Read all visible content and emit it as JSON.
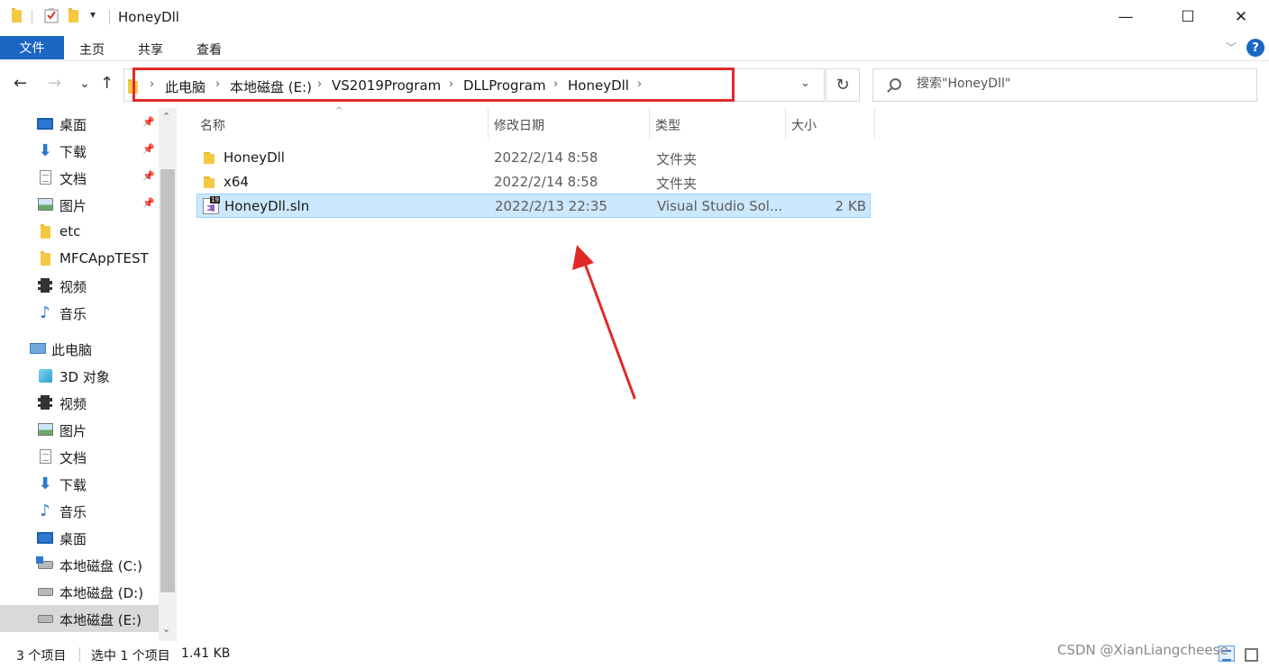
{
  "window": {
    "title": "HoneyDll",
    "minimize_glyph": "—",
    "maximize_glyph": "☐",
    "close_glyph": "✕",
    "qa_dropdown_glyph": "▾"
  },
  "ribbon": {
    "file_tab": "文件",
    "tabs": [
      "主页",
      "共享",
      "查看"
    ],
    "expand_glyph": "﹀",
    "help_glyph": "?"
  },
  "nav": {
    "back_glyph": "←",
    "forward_glyph": "→",
    "recent_glyph": "⌄",
    "up_glyph": "↑",
    "refresh_glyph": "↻",
    "dropdown_glyph": "⌄"
  },
  "address": {
    "breadcrumbs": [
      "此电脑",
      "本地磁盘 (E:)",
      "VS2019Program",
      "DLLProgram",
      "HoneyDll"
    ],
    "separator": "›"
  },
  "search": {
    "placeholder": "搜索\"HoneyDll\""
  },
  "navpane": {
    "quick_access": [
      {
        "label": "桌面",
        "icon": "desktop-icon",
        "pinned": true
      },
      {
        "label": "下载",
        "icon": "download-icon",
        "pinned": true
      },
      {
        "label": "文档",
        "icon": "document-icon",
        "pinned": true
      },
      {
        "label": "图片",
        "icon": "picture-icon",
        "pinned": true
      },
      {
        "label": "etc",
        "icon": "folder-icon",
        "pinned": false
      },
      {
        "label": "MFCAppTEST",
        "icon": "folder-icon",
        "pinned": false
      },
      {
        "label": "视频",
        "icon": "video-icon",
        "pinned": false
      },
      {
        "label": "音乐",
        "icon": "music-icon",
        "pinned": false
      }
    ],
    "this_pc": "此电脑",
    "this_pc_items": [
      {
        "label": "3D 对象",
        "icon": "3d-objects-icon"
      },
      {
        "label": "视频",
        "icon": "video-icon"
      },
      {
        "label": "图片",
        "icon": "picture-icon"
      },
      {
        "label": "文档",
        "icon": "document-icon"
      },
      {
        "label": "下载",
        "icon": "download-icon"
      },
      {
        "label": "音乐",
        "icon": "music-icon"
      },
      {
        "label": "桌面",
        "icon": "desktop-icon"
      },
      {
        "label": "本地磁盘 (C:)",
        "icon": "system-drive-icon"
      },
      {
        "label": "本地磁盘 (D:)",
        "icon": "drive-icon"
      },
      {
        "label": "本地磁盘 (E:)",
        "icon": "drive-icon",
        "selected": true
      }
    ],
    "pin_glyph": "📌",
    "scroll_up_glyph": "⌃",
    "scroll_down_glyph": "⌄"
  },
  "filelist": {
    "columns": {
      "name": "名称",
      "date": "修改日期",
      "type": "类型",
      "size": "大小"
    },
    "sort_glyph": "^",
    "rows": [
      {
        "name": "HoneyDll",
        "date": "2022/2/14 8:58",
        "type": "文件夹",
        "size": "",
        "icon": "folder-icon",
        "selected": false
      },
      {
        "name": "x64",
        "date": "2022/2/14 8:58",
        "type": "文件夹",
        "size": "",
        "icon": "folder-icon",
        "selected": false
      },
      {
        "name": "HoneyDll.sln",
        "date": "2022/2/13 22:35",
        "type": "Visual Studio Sol...",
        "size": "2 KB",
        "icon": "visual-studio-solution-icon",
        "selected": true
      }
    ]
  },
  "status": {
    "item_count": "3 个项目",
    "selection": "选中 1 个项目",
    "selection_size": "1.41 KB"
  },
  "watermark": "CSDN @XianLiangcheese",
  "colors": {
    "accent": "#1a66c2",
    "selection_bg": "#cce8ff",
    "annotation_red": "#e02a2a"
  }
}
